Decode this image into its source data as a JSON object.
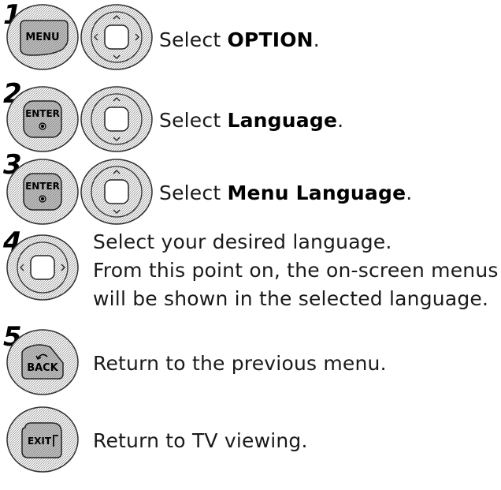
{
  "steps": [
    {
      "number": "1",
      "prefix": "Select ",
      "bold": "OPTION",
      "suffix": ".",
      "buttons": [
        "MENU",
        "nav-full"
      ]
    },
    {
      "number": "2",
      "prefix": "Select ",
      "bold": "Language",
      "suffix": ".",
      "buttons": [
        "ENTER",
        "nav-updown"
      ]
    },
    {
      "number": "3",
      "prefix": "Select ",
      "bold": "Menu Language",
      "suffix": ".",
      "buttons": [
        "ENTER",
        "nav-updown"
      ]
    },
    {
      "number": "4",
      "line1": "Select your desired language.",
      "line2": "From this point on, the on-screen menus",
      "line3": "will be shown in the selected language.",
      "buttons": [
        "nav-leftright"
      ]
    },
    {
      "number": "5",
      "text": "Return to the previous menu.",
      "buttons": [
        "BACK"
      ]
    },
    {
      "text": "Return to TV viewing.",
      "buttons": [
        "EXIT"
      ]
    }
  ],
  "labels": {
    "menu": "MENU",
    "enter": "ENTER",
    "back": "BACK",
    "exit": "EXIT"
  },
  "colors": {
    "button_fill": "#cfcfcf",
    "outline": "#333333",
    "text": "#1a1a1a"
  }
}
